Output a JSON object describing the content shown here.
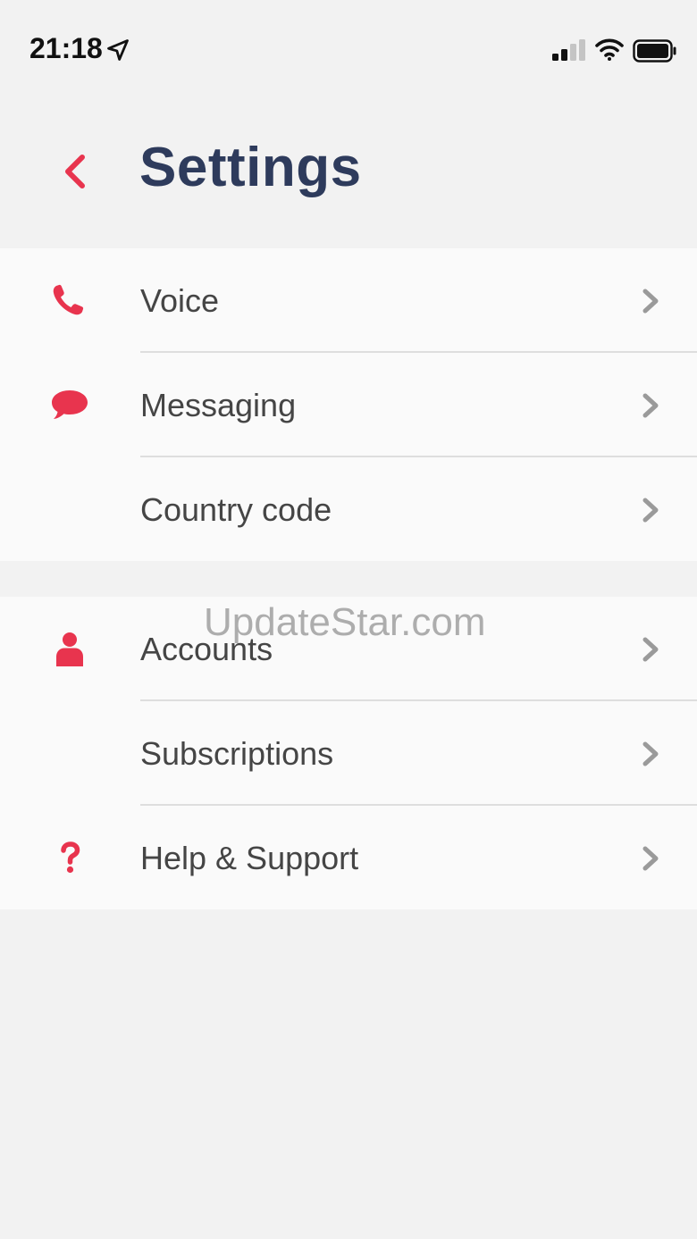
{
  "status_bar": {
    "time": "21:18",
    "icons": [
      "location-arrow-icon",
      "signal-icon",
      "wifi-icon",
      "battery-icon"
    ]
  },
  "header": {
    "title": "Settings",
    "back_icon": "chevron-left-icon"
  },
  "sections": [
    {
      "items": [
        {
          "label": "Voice",
          "icon": "phone-icon"
        },
        {
          "label": "Messaging",
          "icon": "chat-bubble-icon"
        },
        {
          "label": "Country code",
          "icon": ""
        }
      ]
    },
    {
      "items": [
        {
          "label": "Accounts",
          "icon": "person-icon"
        },
        {
          "label": "Subscriptions",
          "icon": ""
        },
        {
          "label": "Help & Support",
          "icon": "question-icon"
        }
      ]
    }
  ],
  "watermark": "UpdateStar.com",
  "colors": {
    "accent": "#e8344e",
    "title": "#2e3b5c",
    "chevron": "#9a9a9a",
    "background": "#f2f2f2",
    "row_background": "#fafafa"
  }
}
